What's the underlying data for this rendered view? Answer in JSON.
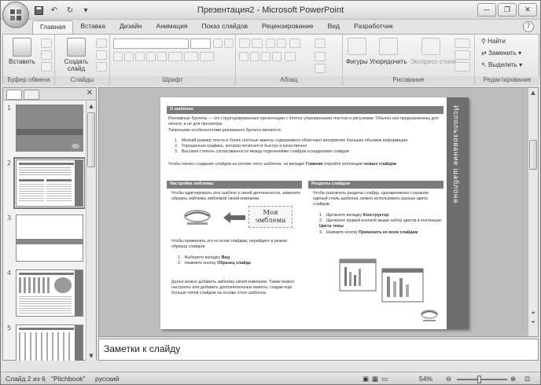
{
  "window": {
    "title": "Презентация2 - Microsoft PowerPoint"
  },
  "tabs": [
    "Главная",
    "Вставка",
    "Дизайн",
    "Анимация",
    "Показ слайдов",
    "Рецензирование",
    "Вид",
    "Разработчик"
  ],
  "ribbon": {
    "clipboard": {
      "paste_label": "Вставить",
      "group_label": "Буфер обмена"
    },
    "slides": {
      "new_slide_label": "Создать слайд",
      "group_label": "Слайды"
    },
    "font": {
      "group_label": "Шрифт"
    },
    "paragraph": {
      "group_label": "Абзац"
    },
    "drawing": {
      "shapes_label": "Фигуры",
      "arrange_label": "Упорядочить",
      "styles_label": "Экспресс-стили",
      "group_label": "Рисование"
    },
    "editing": {
      "find_label": "Найти",
      "replace_label": "Заменить",
      "select_label": "Выделить",
      "group_label": "Редактирование"
    }
  },
  "thumbnails": [
    {
      "num": "1"
    },
    {
      "num": "2"
    },
    {
      "num": "3"
    },
    {
      "num": "4"
    },
    {
      "num": "5"
    }
  ],
  "slide": {
    "side_title": "Использование шаблона",
    "sec1_title": "О шаблоне",
    "sec1_intro": "Рекламные буклеты — это структурированные презентации с плотно упакованными текстом и рисунками. Обычно они предназначены для печати, а не для просмотра.",
    "sec1_features_lead": "Типичными особенностями рекламного буклета являются:",
    "sec1_items": [
      "Мелкий размер текста и более плотные макеты содержимого облегчают восприятие больших объемов информации",
      "Упрощенная графика, которая печатается быстро и качественно",
      "Высокая степень согласованности между отделениями слайдов и разделами слайдов"
    ],
    "sec1_footer_pre": "Чтобы начать создание слайдов на основе этого шаблона, на вкладке ",
    "sec1_footer_b1": "Главная",
    "sec1_footer_mid": " откройте коллекцию ",
    "sec1_footer_b2": "новых слайдов",
    "sec2_title": "Настройка эмблемы",
    "sec2_text": "Чтобы адаптировать этот шаблон к своей деятельности, замените образец эмблемы эмблемой своей компании.",
    "emblem_text": "Моя эмблема",
    "sec2_apply": "Чтобы применить это ко всем слайдам, перейдите в режим образца слайдов.",
    "sec2_steps": [
      {
        "text": "Выберите вкладку ",
        "bold": "Вид"
      },
      {
        "text": "Нажмите кнопку ",
        "bold": "Образец слайда"
      }
    ],
    "sec2_footer": "Далее можно добавить эмблему своей компании. Также можно настроить или добавить дополнительные макеты, создав еще больше типов слайдов на основе этого шаблона.",
    "sec3_title": "Разделы слайдов",
    "sec3_text": "Чтобы различать разделы слайда, одновременно сохраняя единый стиль шаблона, можно использовать разные цвета слайдов:",
    "sec3_steps": [
      {
        "text": "Щелкните вкладку ",
        "bold": "Конструктор"
      },
      {
        "text": "Щелкните правой кнопкой мыши набор цветов в коллекции ",
        "bold": "Цвета темы"
      },
      {
        "text": "Нажмите кнопку ",
        "bold": "Применить ко всем слайдам"
      }
    ]
  },
  "notes": {
    "placeholder": "Заметки к слайду"
  },
  "status": {
    "slide_info": "Слайд 2 из 6",
    "theme": "\"Pitchbook\"",
    "language": "русский",
    "zoom": "54%"
  }
}
